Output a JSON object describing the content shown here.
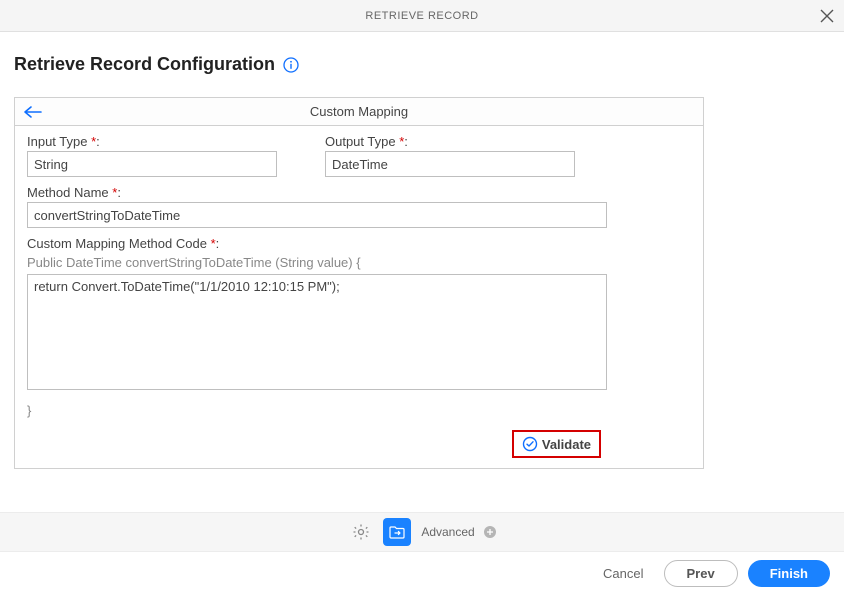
{
  "header": {
    "title": "RETRIEVE RECORD"
  },
  "page": {
    "title": "Retrieve Record Configuration"
  },
  "panel": {
    "title": "Custom Mapping",
    "input_type_label": "Input Type",
    "input_type_value": "String",
    "output_type_label": "Output Type",
    "output_type_value": "DateTime",
    "method_name_label": "Method Name",
    "method_name_value": "convertStringToDateTime",
    "code_label": "Custom Mapping Method Code",
    "signature": "Public DateTime convertStringToDateTime (String value) {",
    "code_value": "return Convert.ToDateTime(\"1/1/2010 12:10:15 PM\");",
    "close_brace": "}",
    "validate_label": "Validate",
    "required_mark": "*",
    "colon": ":"
  },
  "toolbar": {
    "advanced_label": "Advanced"
  },
  "footer": {
    "cancel": "Cancel",
    "prev": "Prev",
    "finish": "Finish"
  }
}
